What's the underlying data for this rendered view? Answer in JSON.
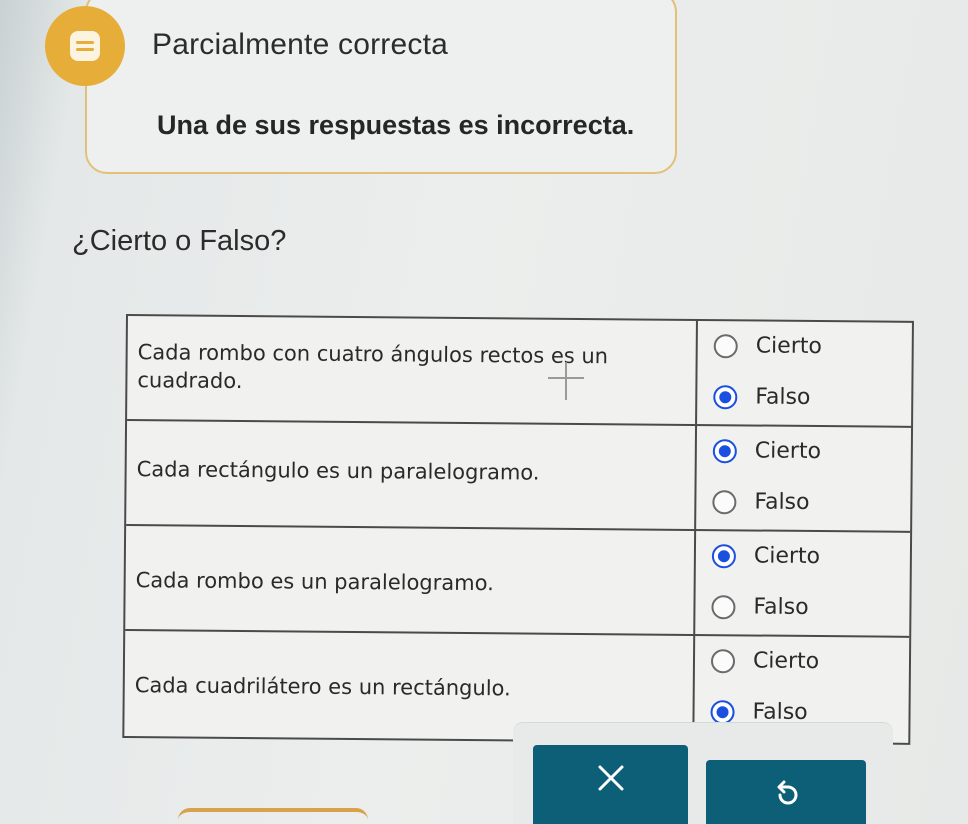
{
  "feedback": {
    "status_icon": "partial-correct-icon",
    "status_title": "Parcialmente correcta",
    "message": "Una de sus respuestas es incorrecta.",
    "accent_color": "#e6ad38"
  },
  "question": {
    "title": "¿Cierto o Falso?"
  },
  "rows": [
    {
      "statement": "Cada rombo con cuatro ángulos rectos es un cuadrado.",
      "options": [
        {
          "label": "Cierto",
          "selected": false
        },
        {
          "label": "Falso",
          "selected": true
        }
      ]
    },
    {
      "statement": "Cada rectángulo es un paralelogramo.",
      "options": [
        {
          "label": "Cierto",
          "selected": true
        },
        {
          "label": "Falso",
          "selected": false
        }
      ]
    },
    {
      "statement": "Cada rombo es un paralelogramo.",
      "options": [
        {
          "label": "Cierto",
          "selected": true
        },
        {
          "label": "Falso",
          "selected": false
        }
      ]
    },
    {
      "statement": "Cada cuadrilátero es un rectángulo.",
      "options": [
        {
          "label": "Cierto",
          "selected": false
        },
        {
          "label": "Falso",
          "selected": true
        }
      ]
    }
  ],
  "actions": {
    "clear_icon": "close-icon",
    "undo_icon": "undo-icon",
    "button_color": "#0d5f77",
    "radio_selected_color": "#1a4fe0"
  }
}
